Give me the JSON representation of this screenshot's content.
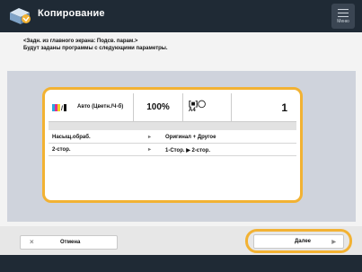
{
  "header": {
    "title": "Копирование",
    "menu_label": "Меню",
    "app_icon": "copy-app-icon"
  },
  "instructions": {
    "line1": "<Задн. из главного экрана: Подсв. парам.>",
    "line2": "Будут заданы программы с следующими параметры."
  },
  "summary": {
    "color_mode": "Авто (Цветн./Ч-б)",
    "zoom": "100%",
    "paper_icon": "[■]◯",
    "paper": "A4",
    "copies": "1"
  },
  "settings": [
    {
      "key": "Насыщ.обраб.",
      "value": "Оригинал + Другое"
    },
    {
      "key": "2-стор.",
      "value": "1-Стор. ▶ 2-стор."
    }
  ],
  "buttons": {
    "cancel": "Отмена",
    "next": "Далее"
  },
  "colors": {
    "topbar": "#1f2a35",
    "accent": "#f2b233",
    "panel": "#cfd3dc"
  }
}
